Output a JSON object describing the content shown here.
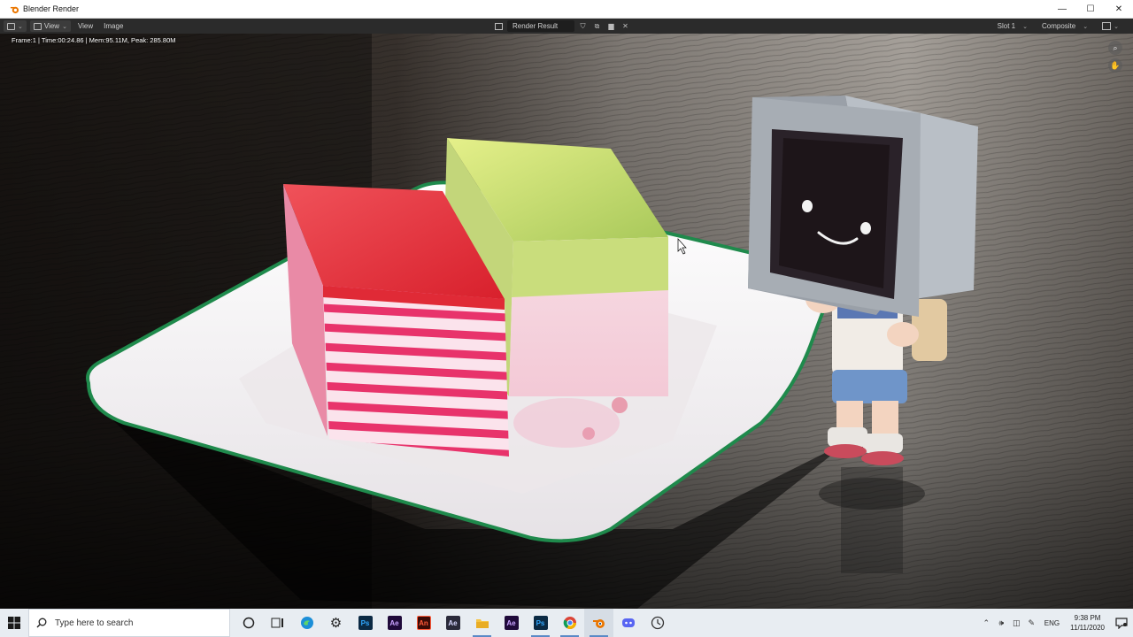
{
  "window": {
    "title": "Blender Render",
    "minimize_label": "—",
    "maximize_label": "☐",
    "close_label": "✕"
  },
  "image_editor_header": {
    "view_menu": "View",
    "menu_view": "View",
    "menu_image": "Image",
    "image_name": "Render Result",
    "slot_label": "Slot 1",
    "layer_label": "Composite"
  },
  "render_stats": "Frame:1 | Time:00:24.86 | Mem:95.11M, Peak: 285.80M",
  "taskbar": {
    "search_placeholder": "Type here to search",
    "apps": [
      {
        "name": "task-view",
        "label": ""
      },
      {
        "name": "edge",
        "label": ""
      },
      {
        "name": "settings",
        "label": ""
      },
      {
        "name": "photoshop",
        "label": "Ps"
      },
      {
        "name": "after-effects",
        "label": "Ae"
      },
      {
        "name": "acrobat",
        "label": "An"
      },
      {
        "name": "media-encoder",
        "label": "Ae"
      },
      {
        "name": "file-explorer",
        "label": ""
      },
      {
        "name": "after-effects-2",
        "label": "Ae"
      },
      {
        "name": "photoshop-2",
        "label": "Ps"
      },
      {
        "name": "chrome",
        "label": ""
      },
      {
        "name": "blender",
        "label": ""
      },
      {
        "name": "discord",
        "label": ""
      },
      {
        "name": "clock-app",
        "label": ""
      }
    ],
    "tray_language": "ENG",
    "clock_time": "9:38 PM",
    "clock_date": "11/11/2020"
  },
  "colors": {
    "accent": "#5a8ac6",
    "blender_orange": "#ea7600",
    "header_bg": "#2b2b2b"
  }
}
